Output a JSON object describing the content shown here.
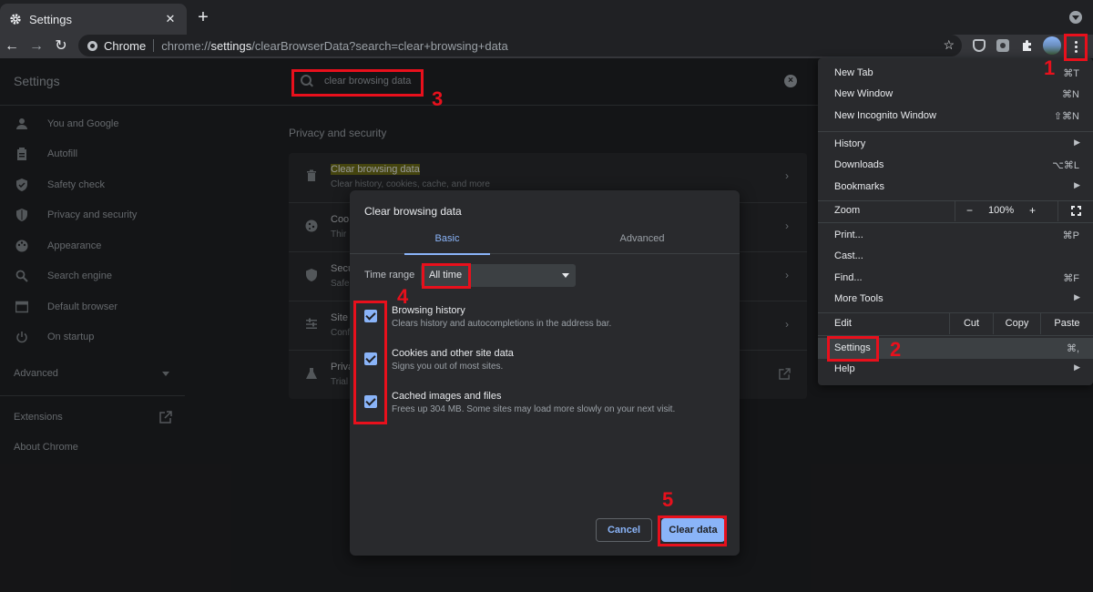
{
  "tab": {
    "title": "Settings",
    "close": "✕",
    "new_tab": "+"
  },
  "toolbar": {
    "back": "←",
    "forward": "→",
    "reload": "↻",
    "chip": "Chrome",
    "url_scheme": "chrome://",
    "url_host": "settings",
    "url_path": "/clearBrowserData?search=clear+browsing+data",
    "star": "☆"
  },
  "header": {
    "title": "Settings",
    "search_value": "clear browsing data",
    "clear": "×"
  },
  "sidebar": {
    "items": [
      {
        "label": "You and Google",
        "icon": "person-icon"
      },
      {
        "label": "Autofill",
        "icon": "clipboard-icon"
      },
      {
        "label": "Safety check",
        "icon": "shield-check-icon"
      },
      {
        "label": "Privacy and security",
        "icon": "shield-icon"
      },
      {
        "label": "Appearance",
        "icon": "palette-icon"
      },
      {
        "label": "Search engine",
        "icon": "search-icon"
      },
      {
        "label": "Default browser",
        "icon": "browser-icon"
      },
      {
        "label": "On startup",
        "icon": "power-icon"
      }
    ],
    "advanced": "Advanced",
    "extensions": "Extensions",
    "about": "About Chrome"
  },
  "main": {
    "section_title": "Privacy and security",
    "rows": [
      {
        "title": "Clear browsing data",
        "sub": "Clear history, cookies, cache, and more"
      },
      {
        "title": "Coo",
        "sub": "Thir"
      },
      {
        "title": "Secu",
        "sub": "Safe"
      },
      {
        "title": "Site",
        "sub": "Conf"
      },
      {
        "title": "Priva",
        "sub": "Trial"
      }
    ]
  },
  "dialog": {
    "title": "Clear browsing data",
    "tab_basic": "Basic",
    "tab_advanced": "Advanced",
    "time_range_label": "Time range",
    "time_range_value": "All time",
    "items": [
      {
        "title": "Browsing history",
        "sub": "Clears history and autocompletions in the address bar.",
        "checked": true
      },
      {
        "title": "Cookies and other site data",
        "sub": "Signs you out of most sites.",
        "checked": true
      },
      {
        "title": "Cached images and files",
        "sub": "Frees up 304 MB. Some sites may load more slowly on your next visit.",
        "checked": true
      }
    ],
    "cancel": "Cancel",
    "clear": "Clear data"
  },
  "menu": {
    "new_tab": {
      "label": "New Tab",
      "shortcut": "⌘T"
    },
    "new_window": {
      "label": "New Window",
      "shortcut": "⌘N"
    },
    "incognito": {
      "label": "New Incognito Window",
      "shortcut": "⇧⌘N"
    },
    "history": {
      "label": "History"
    },
    "downloads": {
      "label": "Downloads",
      "shortcut": "⌥⌘L"
    },
    "bookmarks": {
      "label": "Bookmarks"
    },
    "zoom": {
      "label": "Zoom",
      "minus": "−",
      "value": "100%",
      "plus": "+"
    },
    "print": {
      "label": "Print...",
      "shortcut": "⌘P"
    },
    "cast": {
      "label": "Cast..."
    },
    "find": {
      "label": "Find...",
      "shortcut": "⌘F"
    },
    "more_tools": {
      "label": "More Tools"
    },
    "edit": {
      "label": "Edit",
      "cut": "Cut",
      "copy": "Copy",
      "paste": "Paste"
    },
    "settings": {
      "label": "Settings",
      "shortcut": "⌘,"
    },
    "help": {
      "label": "Help"
    },
    "submenu_arrow": "▶"
  },
  "annotations": {
    "n1": "1",
    "n2": "2",
    "n3": "3",
    "n4": "4",
    "n5": "5"
  },
  "colors": {
    "accent": "#8ab4f8",
    "annotation": "#e8101c",
    "highlight": "#6b6b18"
  }
}
